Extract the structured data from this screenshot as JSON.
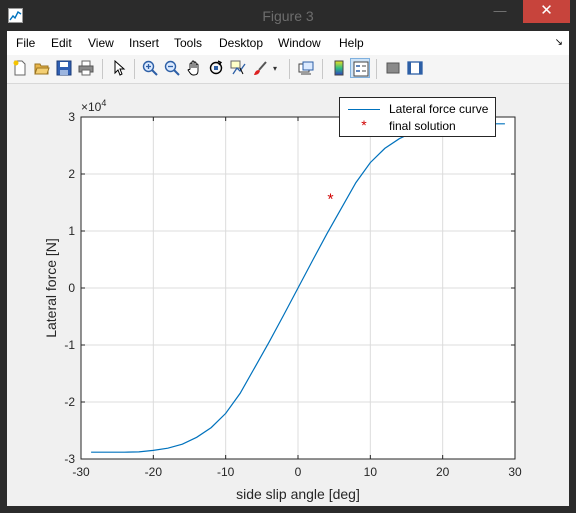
{
  "window": {
    "title": "Figure 3",
    "minimize_glyph": "—",
    "maximize_glyph": "☐",
    "close_glyph": "✕"
  },
  "menu": [
    "File",
    "Edit",
    "View",
    "Insert",
    "Tools",
    "Desktop",
    "Window",
    "Help"
  ],
  "menu_corner_glyph": "↘",
  "toolbar": {
    "items": [
      "new-figure-icon",
      "open-file-icon",
      "save-icon",
      "print-icon",
      "select-pointer-icon",
      "zoom-in-icon",
      "zoom-out-icon",
      "pan-hand-icon",
      "rotate-3d-icon",
      "data-cursor-icon",
      "brush-icon",
      "link-plot-icon",
      "colorbar-icon",
      "legend-icon",
      "hide-plot-tools-icon",
      "show-plot-tools-icon"
    ],
    "active": "legend-icon"
  },
  "colors": {
    "curve": "#0072bd",
    "marker": "#d00000",
    "axes_background": "#ffffff",
    "figure_background": "#f0f0f0",
    "close_button": "#c7443c"
  },
  "chart_data": {
    "type": "line",
    "xlabel": "side slip angle [deg]",
    "ylabel": "Lateral force [N]",
    "y_exponent_label": "×10",
    "y_exponent_power": "4",
    "xlim": [
      -30,
      30
    ],
    "ylim": [
      -30000,
      30000
    ],
    "x_ticks": [
      -30,
      -20,
      -10,
      0,
      10,
      20,
      30
    ],
    "x_tick_labels": [
      "-30",
      "-20",
      "-10",
      "0",
      "10",
      "20",
      "30"
    ],
    "y_ticks": [
      -30000,
      -20000,
      -10000,
      0,
      10000,
      20000,
      30000
    ],
    "y_tick_labels": [
      "-3",
      "-2",
      "-1",
      "0",
      "1",
      "2",
      "3"
    ],
    "grid": true,
    "legend_position": "top-right",
    "series": [
      {
        "name": "Lateral force curve",
        "style": "line",
        "x": [
          -28.6,
          -26,
          -24,
          -22,
          -20,
          -18,
          -16,
          -14,
          -12,
          -10,
          -8,
          -6,
          -4,
          -2,
          0,
          2,
          4,
          6,
          8,
          10,
          12,
          14,
          16,
          18,
          20,
          22,
          24,
          26,
          28.6
        ],
        "y": [
          -28800,
          -28800,
          -28800,
          -28750,
          -28500,
          -28100,
          -27400,
          -26200,
          -24500,
          -22000,
          -18500,
          -14000,
          -9500,
          -4800,
          0,
          4800,
          9500,
          14000,
          18500,
          22000,
          24500,
          26200,
          27400,
          28100,
          28500,
          28750,
          28800,
          28800,
          28800
        ]
      },
      {
        "name": "final solution",
        "style": "marker",
        "marker": "*",
        "x": [
          4.5
        ],
        "y": [
          15700
        ]
      }
    ]
  }
}
